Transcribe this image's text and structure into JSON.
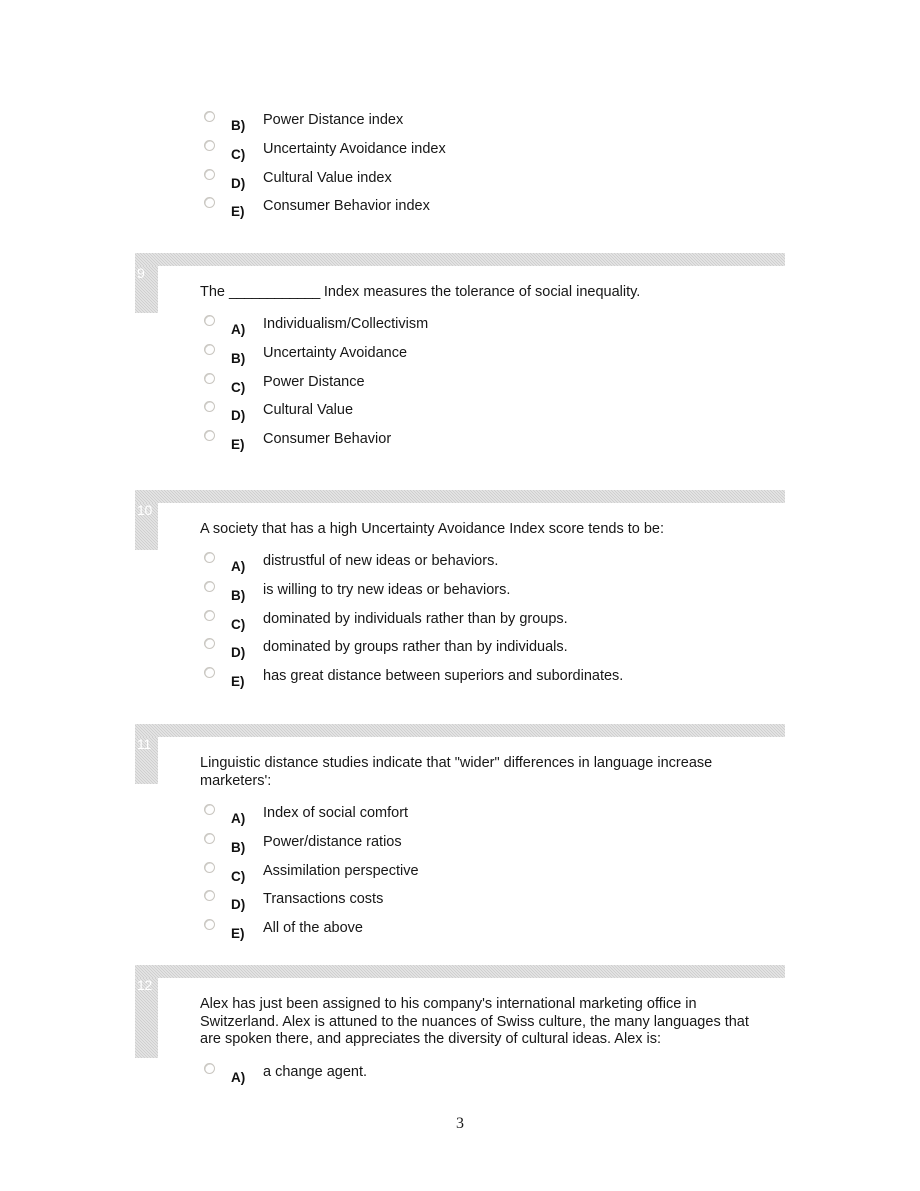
{
  "document": {
    "page_number": "3",
    "accent_gray": "#cfcfcf",
    "text_color": "#171717"
  },
  "continued_options": [
    {
      "letter": "B)",
      "text": "Power Distance index",
      "icon": "radio-unselected-icon"
    },
    {
      "letter": "C)",
      "text": "Uncertainty Avoidance index",
      "icon": "radio-unselected-icon"
    },
    {
      "letter": "D)",
      "text": "Cultural Value index",
      "icon": "radio-unselected-icon"
    },
    {
      "letter": "E)",
      "text": "Consumer Behavior index",
      "icon": "radio-unselected-icon"
    }
  ],
  "questions": [
    {
      "number": "9",
      "stem_before_blank": "The ",
      "blank": "____________",
      "stem_after_blank": " Index measures the tolerance of social inequality.",
      "options": [
        {
          "letter": "A)",
          "text": "Individualism/Collectivism"
        },
        {
          "letter": "B)",
          "text": "Uncertainty Avoidance"
        },
        {
          "letter": "C)",
          "text": "Power Distance"
        },
        {
          "letter": "D)",
          "text": "Cultural Value"
        },
        {
          "letter": "E)",
          "text": "Consumer Behavior"
        }
      ]
    },
    {
      "number": "10",
      "stem": "A society that has a high Uncertainty Avoidance Index score tends to be:",
      "options": [
        {
          "letter": "A)",
          "text": "distrustful of new ideas or behaviors."
        },
        {
          "letter": "B)",
          "text": "is willing to try new ideas or behaviors."
        },
        {
          "letter": "C)",
          "text": "dominated by individuals rather than by groups."
        },
        {
          "letter": "D)",
          "text": "dominated by groups rather than by individuals."
        },
        {
          "letter": "E)",
          "text": "has great distance between superiors and subordinates."
        }
      ]
    },
    {
      "number": "11",
      "stem": "Linguistic distance studies indicate that \"wider\" differences in language increase marketers':",
      "options": [
        {
          "letter": "A)",
          "text": "Index of social comfort"
        },
        {
          "letter": "B)",
          "text": "Power/distance ratios"
        },
        {
          "letter": "C)",
          "text": "Assimilation perspective"
        },
        {
          "letter": "D)",
          "text": "Transactions costs"
        },
        {
          "letter": "E)",
          "text": "All of the above"
        }
      ]
    },
    {
      "number": "12",
      "stem": "Alex has just been assigned to his company's international marketing office in Switzerland. Alex is attuned to the nuances of Swiss culture, the many languages that are spoken there, and appreciates the diversity of cultural ideas. Alex is:",
      "options": [
        {
          "letter": "A)",
          "text": "a change agent."
        }
      ]
    }
  ]
}
